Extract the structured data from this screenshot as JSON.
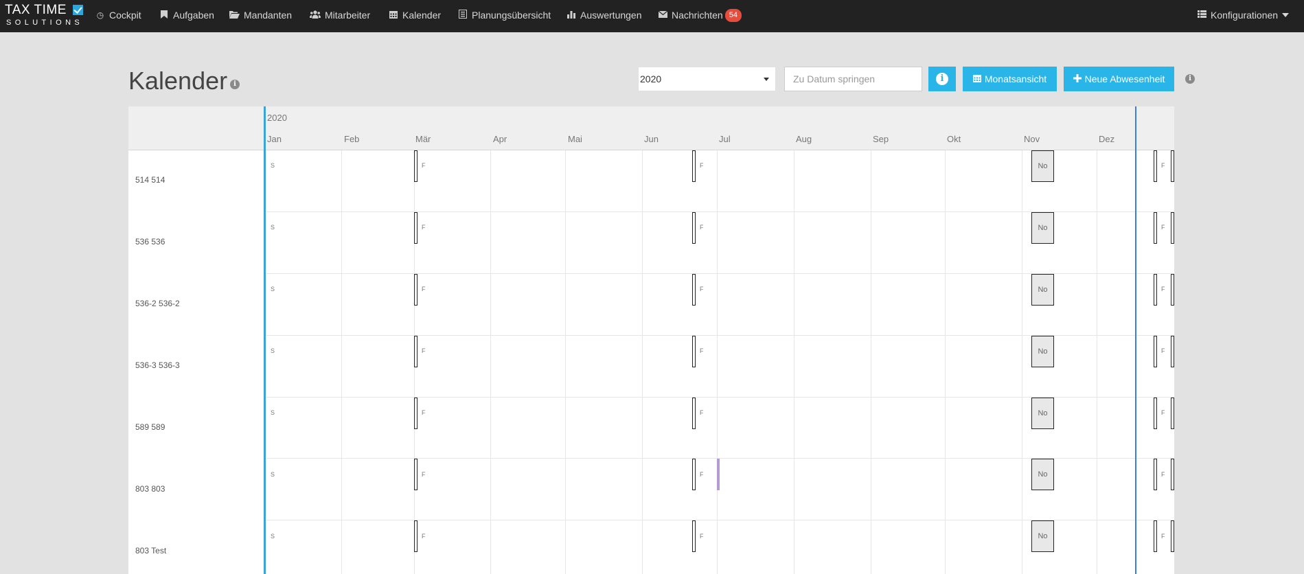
{
  "app": {
    "logo_main": "TAX TIME",
    "logo_sub": "SOLUTIONS"
  },
  "nav": {
    "items": [
      {
        "label": "Cockpit",
        "icon": "dashboard-icon"
      },
      {
        "label": "Aufgaben",
        "icon": "bookmark-icon"
      },
      {
        "label": "Mandanten",
        "icon": "folder-open-icon"
      },
      {
        "label": "Mitarbeiter",
        "icon": "users-icon"
      },
      {
        "label": "Kalender",
        "icon": "calendar-icon"
      },
      {
        "label": "Planungsübersicht",
        "icon": "list-alt-icon"
      },
      {
        "label": "Auswertungen",
        "icon": "bar-chart-icon"
      },
      {
        "label": "Nachrichten",
        "icon": "envelope-icon",
        "badge": "54"
      }
    ],
    "config_label": "Konfigurationen"
  },
  "page": {
    "title": "Kalender"
  },
  "toolbar": {
    "year_value": "2020",
    "date_placeholder": "Zu Datum springen",
    "month_view_label": "Monatsansicht",
    "new_absence_label": "Neue Abwesenheit"
  },
  "calendar": {
    "year": "2020",
    "months": [
      "Jan",
      "Feb",
      "Mär",
      "Apr",
      "Mai",
      "Jun",
      "Jul",
      "Aug",
      "Sep",
      "Okt",
      "Nov",
      "Dez"
    ],
    "rows": [
      {
        "name": "514 514"
      },
      {
        "name": "536 536"
      },
      {
        "name": "536-2 536-2"
      },
      {
        "name": "536-3 536-3"
      },
      {
        "name": "589 589"
      },
      {
        "name": "803 803"
      },
      {
        "name": "803 Test"
      }
    ],
    "event_jan": "S",
    "event_mar": "F",
    "event_jun": "F",
    "event_nov": "No",
    "event_next": "F"
  },
  "colors": {
    "navbar": "#222222",
    "accent": "#29b5e8",
    "badge": "#e74c3c",
    "today_line": "#3aa3d8",
    "purple_event": "#b59ad6"
  }
}
